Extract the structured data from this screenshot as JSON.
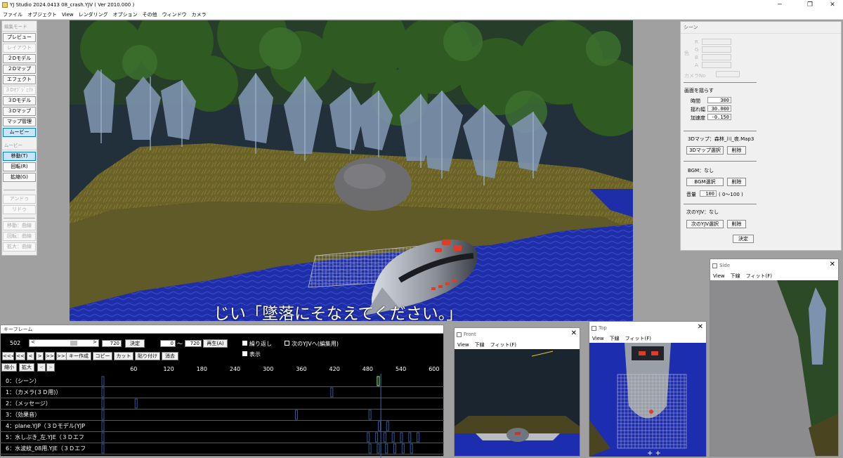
{
  "window": {
    "title": "YJ Studio 2024.0413   08_crash.YJV ( Ver 2010.000 )",
    "min": "─",
    "max": "❐",
    "close": "✕"
  },
  "menu": [
    "ファイル",
    "オブジェクト",
    "View",
    "レンダリング",
    "オプション",
    "その他",
    "ウィンドウ",
    "カメラ"
  ],
  "mode_panel": {
    "header": "編集モード",
    "items": [
      {
        "label": "プレビュー",
        "state": "normal"
      },
      {
        "label": "レイアウト",
        "state": "disabled"
      },
      {
        "label": "２Dモデル",
        "state": "normal"
      },
      {
        "label": "２Dマップ",
        "state": "normal"
      },
      {
        "label": "エフェクト",
        "state": "normal"
      },
      {
        "label": "３Dｵﾌﾞｼﾞｪｸﾄ",
        "state": "disabled"
      },
      {
        "label": "３Dモデル",
        "state": "normal"
      },
      {
        "label": "３Dマップ",
        "state": "normal"
      },
      {
        "label": "マップ管理",
        "state": "normal"
      },
      {
        "label": "ムービー",
        "state": "active"
      }
    ],
    "movie_header": "ムービー",
    "movie_items": [
      {
        "label": "移動(T)",
        "state": "active"
      },
      {
        "label": "回転(R)",
        "state": "normal"
      },
      {
        "label": "拡縮(G)",
        "state": "normal"
      }
    ],
    "undo_items": [
      {
        "label": "アンドゥ",
        "state": "disabled"
      },
      {
        "label": "リドゥ",
        "state": "disabled"
      }
    ],
    "curve_items": [
      {
        "label": "移動：曲線",
        "state": "disabled"
      },
      {
        "label": "回転：曲線",
        "state": "disabled"
      },
      {
        "label": "拡大：曲線",
        "state": "disabled"
      }
    ]
  },
  "viewport": {
    "subtitle": "じい「墜落にそなえてください。」"
  },
  "scene_panel": {
    "header": "シーン",
    "color_label": "色",
    "rgba": [
      "R",
      "G",
      "B",
      "A"
    ],
    "camera_no_label": "カメラNo",
    "shake_title": "画面を揺らす",
    "time_label": "時間",
    "time_value": "300",
    "amp_label": "揺れ幅",
    "amp_value": "30.000",
    "accel_label": "加速度",
    "accel_value": "-0.150",
    "map3d_label": "3Dマップ：森林_川_夜.Map3",
    "map3d_select": "3Dマップ選択",
    "delete": "削除",
    "bgm_label": "BGM：なし",
    "bgm_select": "BGM選択",
    "volume_label": "音量",
    "volume_value": "100",
    "volume_range": "( 0〜100 )",
    "next_label": "次のYJV：なし",
    "next_select": "次のYJV選択",
    "ok": "決定"
  },
  "keyframe": {
    "header": "キーフレーム",
    "frame": "502",
    "end": "720",
    "decide": "決定",
    "range_start": "0",
    "tilde": "〜",
    "range_end": "720",
    "play": "再生(A)",
    "loop_label": "繰り返し",
    "next_edit_label": "次のYJVへ(編集用)",
    "show_label": "表示",
    "nav": [
      "<<<",
      "<<",
      "<",
      ">",
      ">>",
      ">>>"
    ],
    "buttons": [
      "キー作成",
      "コピー",
      "カット",
      "貼り付け",
      "消去"
    ],
    "zoom_out": "縮小",
    "zoom_in": "拡大",
    "scroll": [
      "<",
      ">"
    ],
    "ticks": [
      "60",
      "120",
      "180",
      "240",
      "300",
      "360",
      "420",
      "480",
      "540",
      "600"
    ],
    "tracks": [
      "0：（シーン）",
      "1：（カメラ(３Ｄ用)）",
      "2：（メッセージ）",
      "3：（効果音）",
      "4：plane.YJP（３Ｄモデル(YJP",
      "5：水しぶき_左.YJE（３Ｄエフ",
      "6：水波紋_08用.YJE（３Ｄエフ"
    ],
    "current_frame": 502
  },
  "front": {
    "title": "Front",
    "menu": [
      "View",
      "下線",
      "フィット(F)"
    ]
  },
  "top": {
    "title": "Top",
    "menu": [
      "View",
      "下線",
      "フィット(F)"
    ]
  },
  "side": {
    "title": "Side",
    "menu": [
      "View",
      "下線",
      "フィット(F)"
    ]
  },
  "icons": [
    "app-icon",
    "close-icon",
    "window-icon"
  ]
}
